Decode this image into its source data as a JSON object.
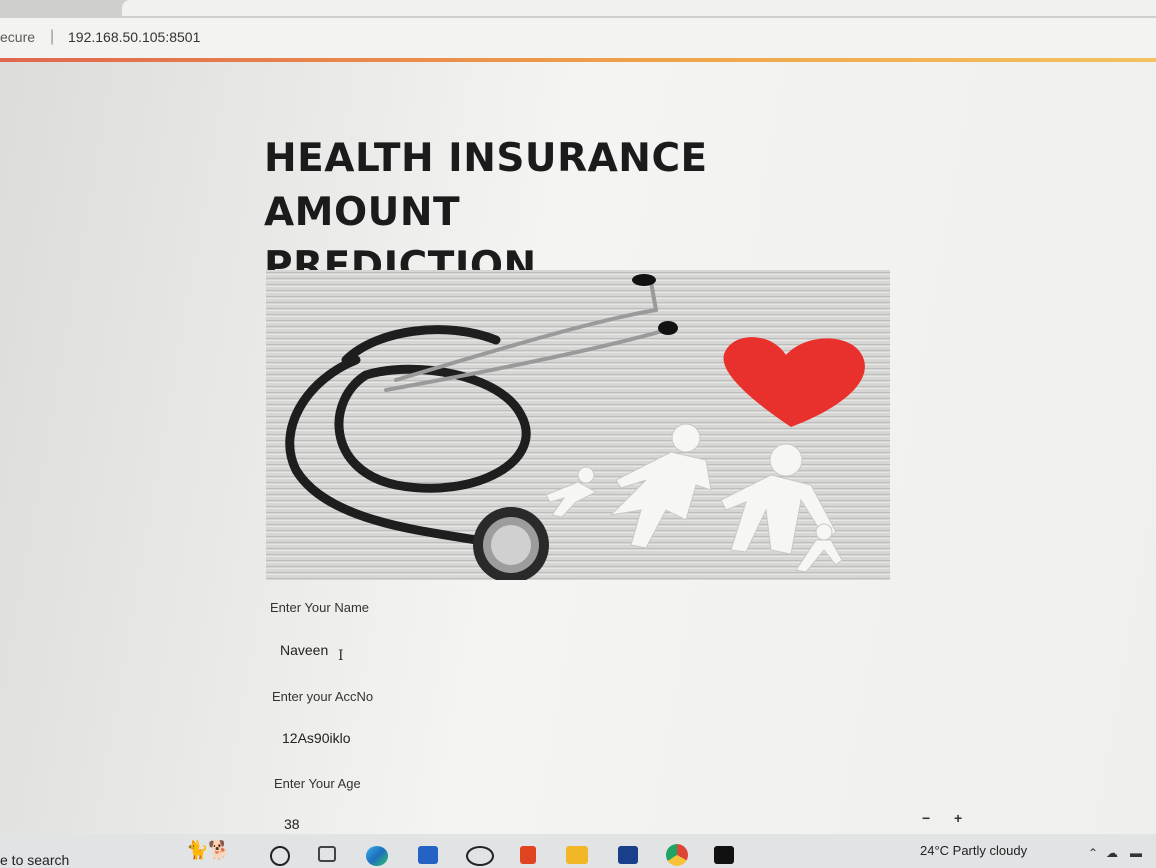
{
  "browser": {
    "security_label": "ecure",
    "separator": "|",
    "url": "192.168.50.105:8501"
  },
  "app": {
    "title_line1": "HEALTH INSURANCE AMOUNT",
    "title_line2": "PREDICTION"
  },
  "form": {
    "name_label": "Enter Your Name",
    "name_value": "Naveen",
    "accno_label": "Enter your AccNo",
    "accno_value": "12As90iklo",
    "age_label": "Enter Your Age",
    "age_value": "38",
    "decrement": "−",
    "increment": "+"
  },
  "taskbar": {
    "search_text": "e to search",
    "weather": "24°C  Partly cloudy",
    "icons": [
      "search-circle-icon",
      "task-view-icon",
      "edge-icon",
      "store-icon",
      "dell-icon",
      "office-icon",
      "file-explorer-icon",
      "vscode-icon",
      "chrome-icon",
      "pycharm-icon"
    ]
  },
  "colors": {
    "accent_start": "#e0674e",
    "accent_end": "#f3c260",
    "heart": "#e8312c"
  }
}
